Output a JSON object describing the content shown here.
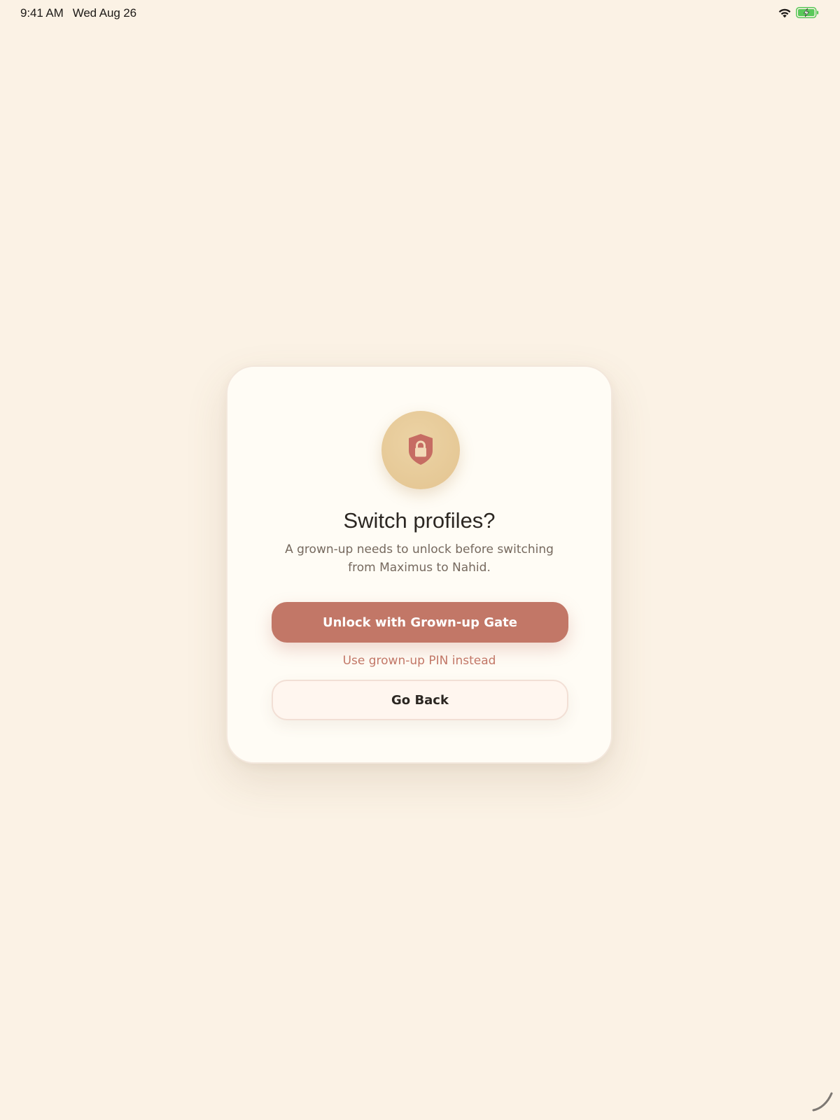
{
  "status_bar": {
    "time": "9:41 AM",
    "date": "Wed Aug 26",
    "icons": [
      "wifi-icon",
      "battery-charging-icon"
    ]
  },
  "dialog": {
    "icon": "shield-lock-icon",
    "title": "Switch profiles?",
    "message": "A grown-up needs to unlock before switching from Maximus to Nahid.",
    "primary_button": "Unlock with Grown-up Gate",
    "pin_link": "Use grown-up PIN instead",
    "secondary_button": "Go Back"
  },
  "colors": {
    "background": "#fbf2e5",
    "card": "#fffcf5",
    "accent": "#c27767",
    "badge": "#e3c490",
    "battery": "#5ac85a"
  }
}
